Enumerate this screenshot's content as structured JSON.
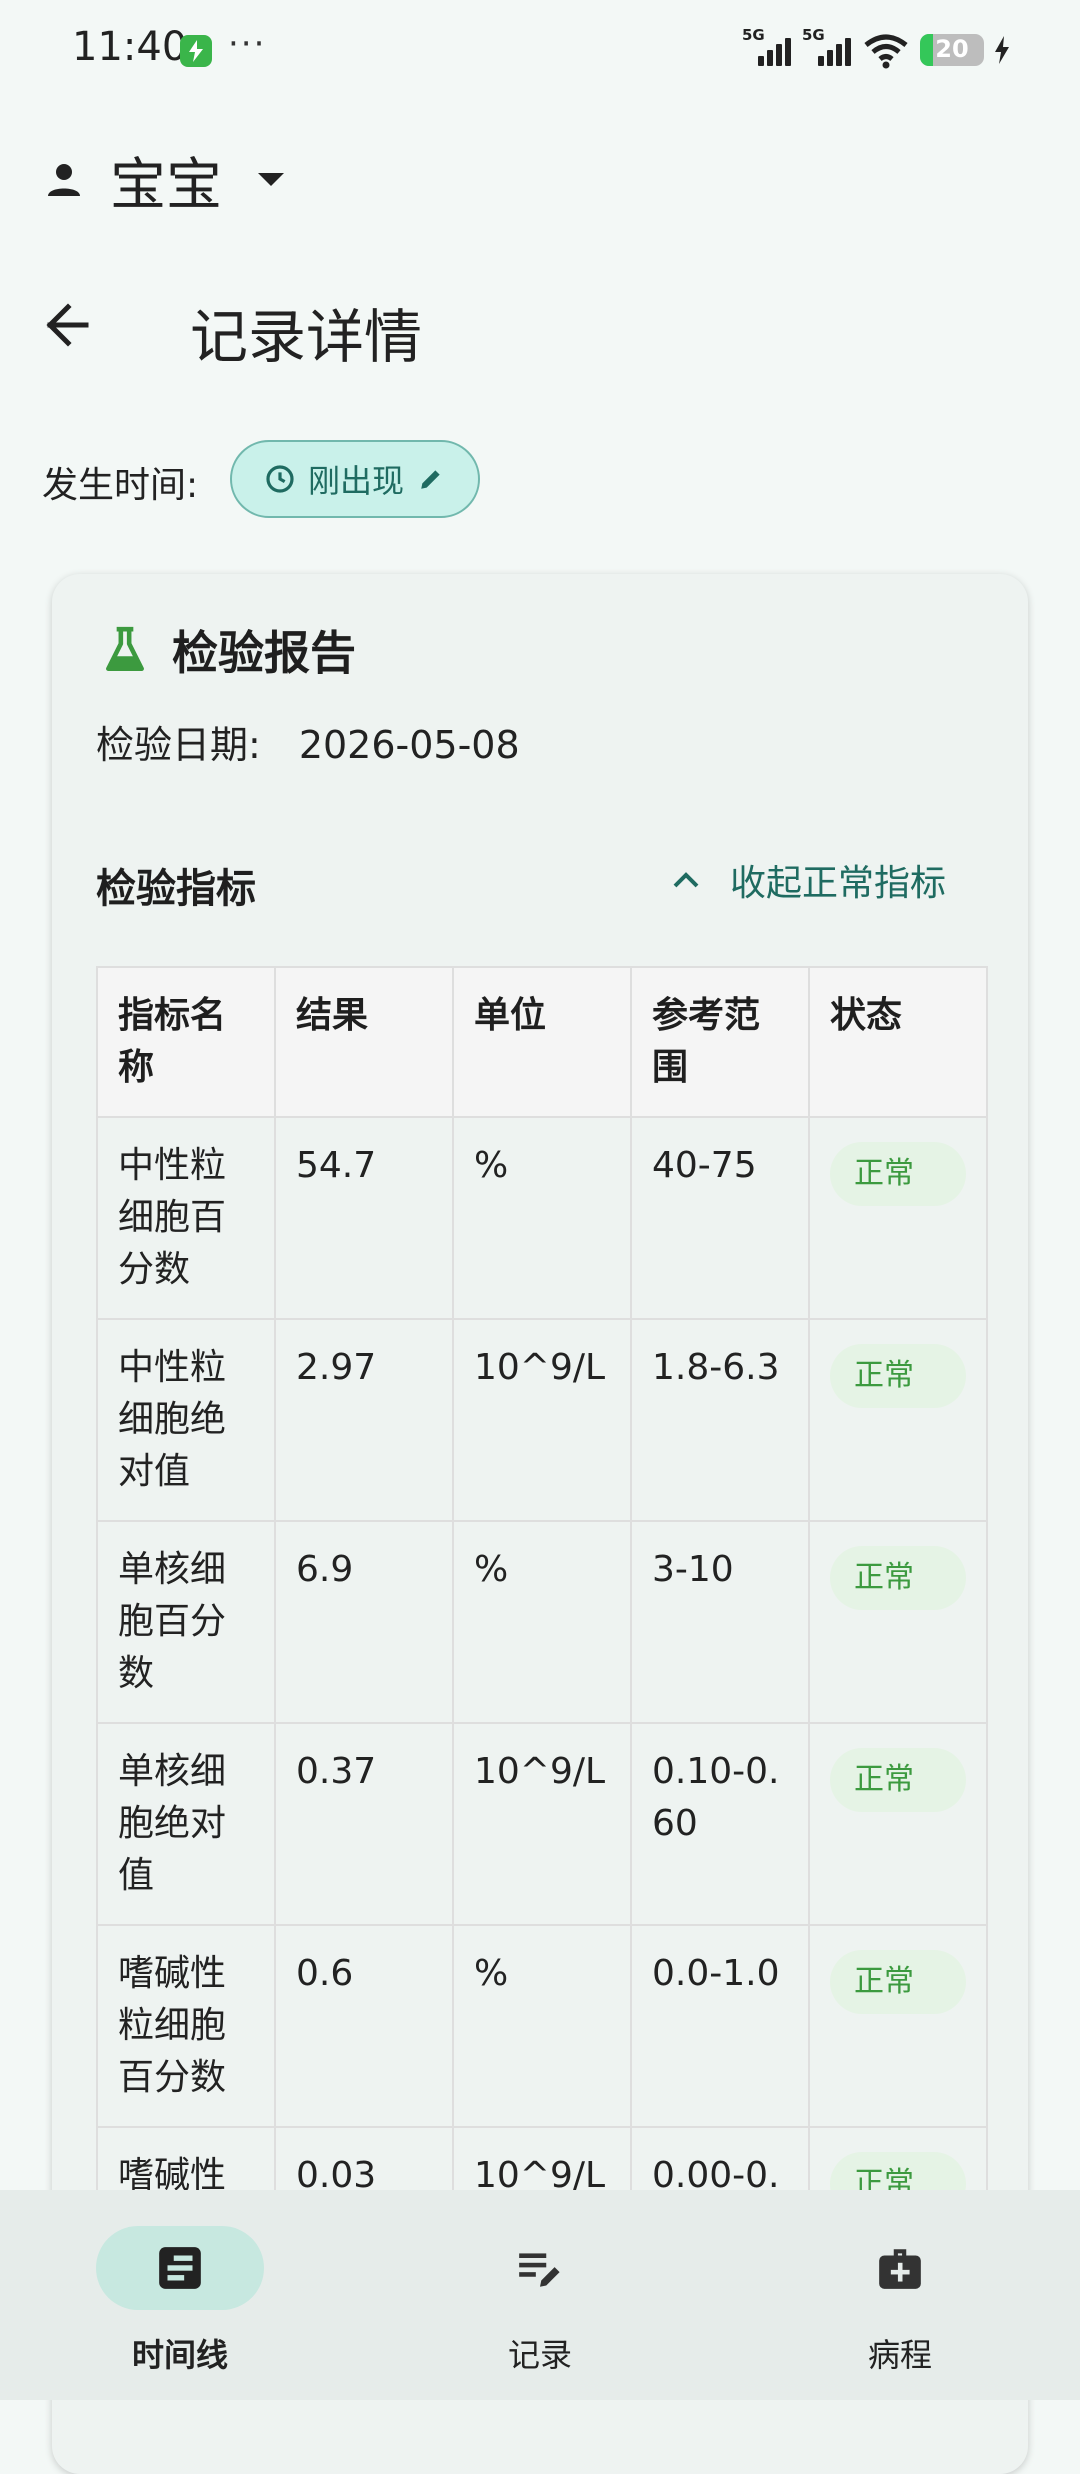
{
  "status_bar": {
    "time": "11:40",
    "more": "···",
    "network_1": "5G",
    "network_2": "5G",
    "battery": "20",
    "battery_level": 0.2
  },
  "profile": {
    "name": "宝宝",
    "icon": "person-icon"
  },
  "header": {
    "title": "记录详情",
    "back_icon": "arrow-back-icon"
  },
  "occurrence": {
    "label": "发生时间:",
    "chip_text": "刚出现"
  },
  "report": {
    "title": "检验报告",
    "icon": "flask-icon",
    "date_label": "检验日期:",
    "date_value": "2026-05-08",
    "section_title": "检验指标",
    "collapse_label": "收起正常指标",
    "columns": [
      "指标名称",
      "结果",
      "单位",
      "参考范围",
      "状态"
    ],
    "rows": [
      {
        "name": "中性粒细胞百分数",
        "result": "54.7",
        "unit": "%",
        "range": "40-75",
        "status": "正常"
      },
      {
        "name": "中性粒细胞绝对值",
        "result": "2.97",
        "unit": "10^9/L",
        "range": "1.8-6.3",
        "status": "正常"
      },
      {
        "name": "单核细胞百分数",
        "result": "6.9",
        "unit": "%",
        "range": "3-10",
        "status": "正常"
      },
      {
        "name": "单核细胞绝对值",
        "result": "0.37",
        "unit": "10^9/L",
        "range": "0.10-0.60",
        "status": "正常"
      },
      {
        "name": "嗜碱性粒细胞百分数",
        "result": "0.6",
        "unit": "%",
        "range": "0.0-1.0",
        "status": "正常"
      },
      {
        "name": "嗜碱性",
        "result": "0.03",
        "unit": "10^9/L",
        "range": "0.00-0.",
        "status": "正常"
      }
    ]
  },
  "nav": {
    "items": [
      {
        "label": "时间线",
        "icon": "timeline-icon",
        "active": true
      },
      {
        "label": "记录",
        "icon": "edit-note-icon",
        "active": false
      },
      {
        "label": "病程",
        "icon": "medical-bag-icon",
        "active": false
      }
    ]
  },
  "colors": {
    "accent": "#1f6b61",
    "chip_bg": "#c9f1ea",
    "status_ok": "#3c9a3f",
    "nav_active": "#c7e8e0"
  }
}
